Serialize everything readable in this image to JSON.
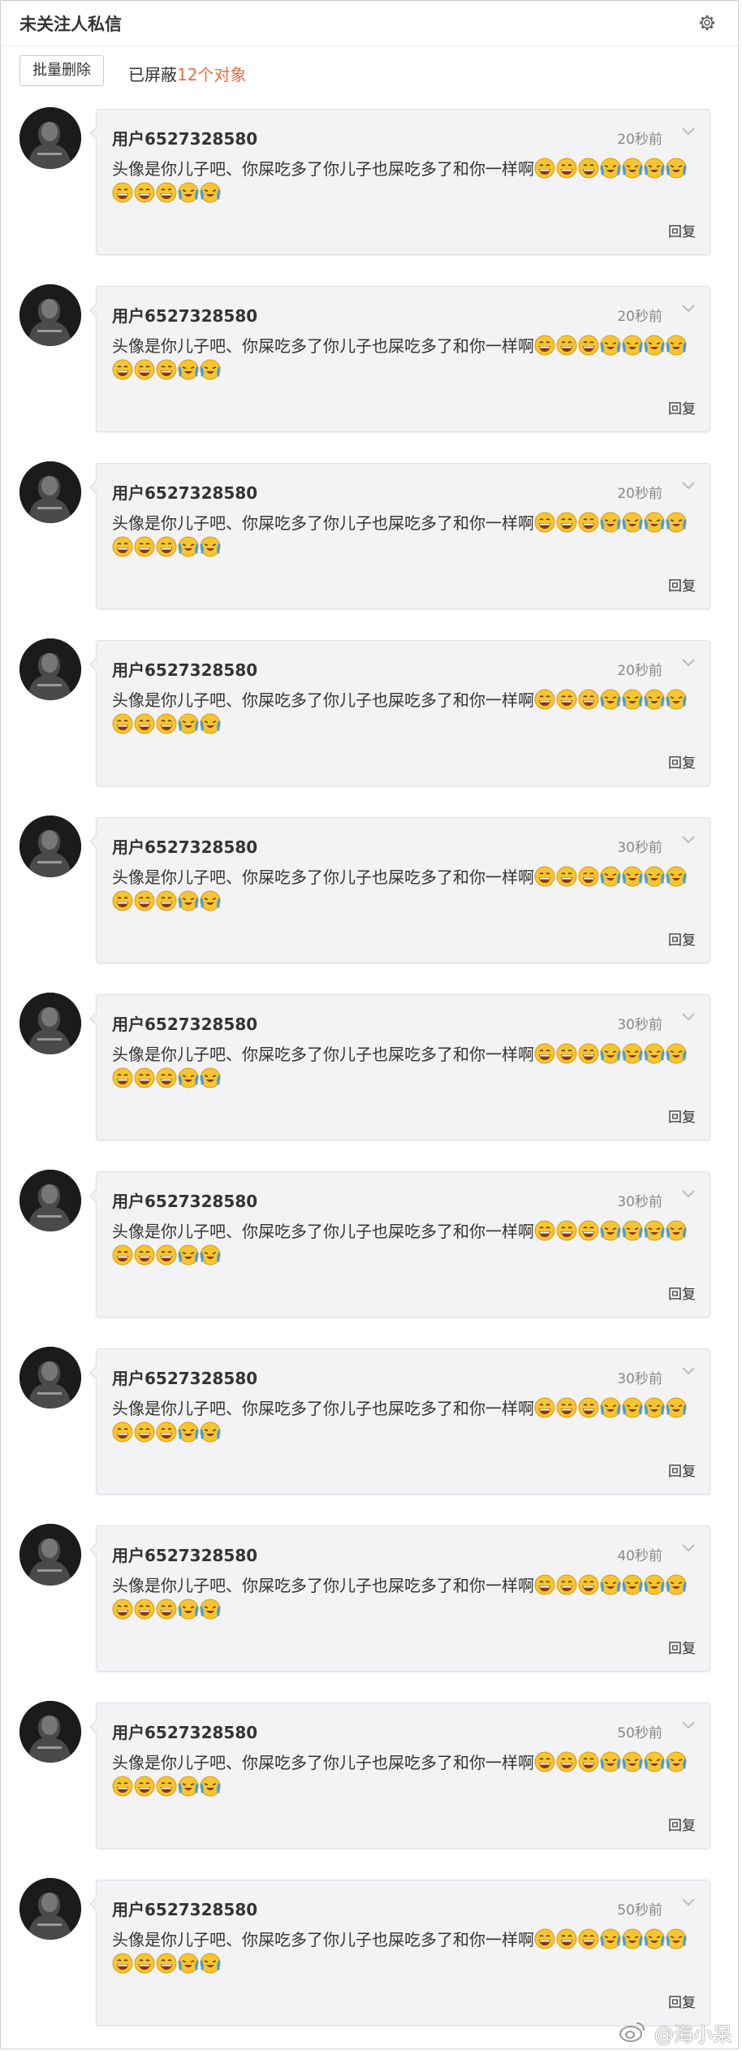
{
  "header": {
    "title": "未关注人私信",
    "settings_icon": "gear-icon"
  },
  "toolbar": {
    "batch_delete": "批量删除",
    "blocked_prefix": "已屏蔽",
    "blocked_count": "12个对象"
  },
  "messages": [
    {
      "user": "用户6527328580",
      "time": "20秒前",
      "text": "头像是你儿子吧、你屎吃多了你儿子也屎吃多了和你一样啊",
      "emojis": [
        "grin",
        "grin",
        "grin",
        "cry",
        "cry",
        "cry",
        "cry",
        "grin",
        "grin",
        "grin",
        "cry",
        "cry"
      ],
      "reply": "回复"
    },
    {
      "user": "用户6527328580",
      "time": "20秒前",
      "text": "头像是你儿子吧、你屎吃多了你儿子也屎吃多了和你一样啊",
      "emojis": [
        "grin",
        "grin",
        "grin",
        "cry",
        "cry",
        "cry",
        "cry",
        "grin",
        "grin",
        "grin",
        "cry",
        "cry"
      ],
      "reply": "回复"
    },
    {
      "user": "用户6527328580",
      "time": "20秒前",
      "text": "头像是你儿子吧、你屎吃多了你儿子也屎吃多了和你一样啊",
      "emojis": [
        "grin",
        "grin",
        "grin",
        "cry",
        "cry",
        "cry",
        "cry",
        "grin",
        "grin",
        "grin",
        "cry",
        "cry"
      ],
      "reply": "回复"
    },
    {
      "user": "用户6527328580",
      "time": "20秒前",
      "text": "头像是你儿子吧、你屎吃多了你儿子也屎吃多了和你一样啊",
      "emojis": [
        "grin",
        "grin",
        "grin",
        "cry",
        "cry",
        "cry",
        "cry",
        "grin",
        "grin",
        "grin",
        "cry",
        "cry"
      ],
      "reply": "回复"
    },
    {
      "user": "用户6527328580",
      "time": "30秒前",
      "text": "头像是你儿子吧、你屎吃多了你儿子也屎吃多了和你一样啊",
      "emojis": [
        "grin",
        "grin",
        "grin",
        "cry",
        "cry",
        "cry",
        "cry",
        "grin",
        "grin",
        "grin",
        "cry",
        "cry"
      ],
      "reply": "回复"
    },
    {
      "user": "用户6527328580",
      "time": "30秒前",
      "text": "头像是你儿子吧、你屎吃多了你儿子也屎吃多了和你一样啊",
      "emojis": [
        "grin",
        "grin",
        "grin",
        "cry",
        "cry",
        "cry",
        "cry",
        "grin",
        "grin",
        "grin",
        "cry",
        "cry"
      ],
      "reply": "回复"
    },
    {
      "user": "用户6527328580",
      "time": "30秒前",
      "text": "头像是你儿子吧、你屎吃多了你儿子也屎吃多了和你一样啊",
      "emojis": [
        "grin",
        "grin",
        "grin",
        "cry",
        "cry",
        "cry",
        "cry",
        "grin",
        "grin",
        "grin",
        "cry",
        "cry"
      ],
      "reply": "回复"
    },
    {
      "user": "用户6527328580",
      "time": "30秒前",
      "text": "头像是你儿子吧、你屎吃多了你儿子也屎吃多了和你一样啊",
      "emojis": [
        "grin",
        "grin",
        "grin",
        "cry",
        "cry",
        "cry",
        "cry",
        "grin",
        "grin",
        "grin",
        "cry",
        "cry"
      ],
      "reply": "回复"
    },
    {
      "user": "用户6527328580",
      "time": "40秒前",
      "text": "头像是你儿子吧、你屎吃多了你儿子也屎吃多了和你一样啊",
      "emojis": [
        "grin",
        "grin",
        "grin",
        "cry",
        "cry",
        "cry",
        "cry",
        "grin",
        "grin",
        "grin",
        "cry",
        "cry"
      ],
      "reply": "回复"
    },
    {
      "user": "用户6527328580",
      "time": "50秒前",
      "text": "头像是你儿子吧、你屎吃多了你儿子也屎吃多了和你一样啊",
      "emojis": [
        "grin",
        "grin",
        "grin",
        "cry",
        "cry",
        "cry",
        "cry",
        "grin",
        "grin",
        "grin",
        "cry",
        "cry"
      ],
      "reply": "回复"
    },
    {
      "user": "用户6527328580",
      "time": "50秒前",
      "text": "头像是你儿子吧、你屎吃多了你儿子也屎吃多了和你一样啊",
      "emojis": [
        "grin",
        "grin",
        "grin",
        "cry",
        "cry",
        "cry",
        "cry",
        "grin",
        "grin",
        "grin",
        "cry",
        "cry"
      ],
      "reply": "回复"
    }
  ],
  "watermark": {
    "text": "@海小呆",
    "icon": "weibo-logo-icon"
  },
  "colors": {
    "accent": "#f36b3b",
    "card_bg": "#f3f3f5",
    "emoji_yellow": "#f7c531",
    "tear_blue": "#3aa0e8"
  }
}
